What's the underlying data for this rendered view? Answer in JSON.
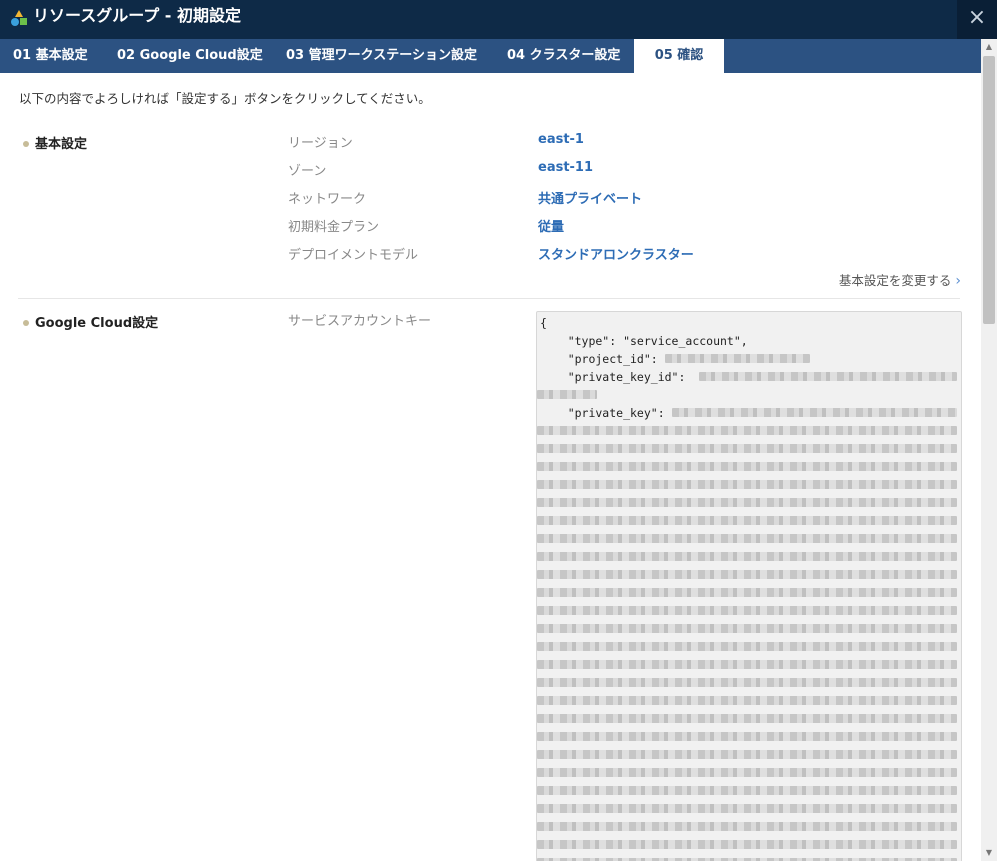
{
  "window": {
    "title": "リソースグループ - 初期設定",
    "close_icon": "×"
  },
  "tabs": [
    {
      "label": "01 基本設定"
    },
    {
      "label": "02 Google Cloud設定"
    },
    {
      "label": "03 管理ワークステーション設定"
    },
    {
      "label": "04 クラスター設定"
    },
    {
      "label": "05 確認",
      "active": true
    }
  ],
  "intro": "以下の内容でよろしければ「設定する」ボタンをクリックしてください。",
  "basic": {
    "title": "基本設定",
    "rows": [
      {
        "label": "リージョン",
        "value": "east-1"
      },
      {
        "label": "ゾーン",
        "value": "east-11"
      },
      {
        "label": "ネットワーク",
        "value": "共通プライベート"
      },
      {
        "label": "初期料金プラン",
        "value": "従量"
      },
      {
        "label": "デプロイメントモデル",
        "value": "スタンドアロンクラスター"
      }
    ],
    "change_link": "基本設定を変更する",
    "chevron_icon": "›"
  },
  "gcloud": {
    "title": "Google Cloud設定",
    "key_label": "サービスアカウントキー",
    "key_lines": [
      "{",
      "    \"type\": \"service_account\",",
      "    \"project_id\": ",
      "    \"private_key_id\": ",
      "",
      "    \"private_key\": "
    ]
  },
  "colors": {
    "titlebar": "#0e2a47",
    "tabbar": "#2c5282",
    "accent": "#2d6cb5",
    "bullet": "#c7bc98"
  }
}
